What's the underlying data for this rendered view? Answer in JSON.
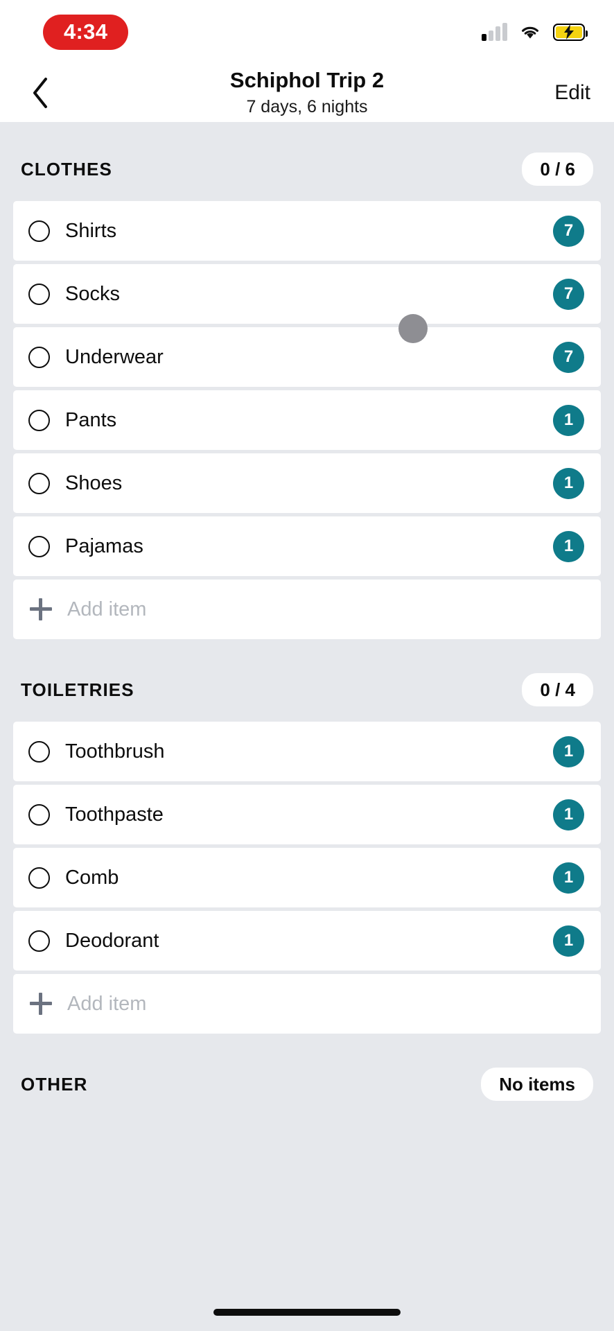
{
  "status_bar": {
    "time": "4:34",
    "time_pill_color": "#e02020",
    "signal_icon": "cellular-signal-icon",
    "wifi_icon": "wifi-icon",
    "battery_icon": "battery-charging-icon",
    "signal_bars_filled": 1,
    "signal_bars_total": 4
  },
  "navbar": {
    "back_icon": "chevron-left-icon",
    "title": "Schiphol Trip 2",
    "subtitle": "7 days, 6 nights",
    "edit_label": "Edit"
  },
  "theme": {
    "accent": "#0f7b8a",
    "page_background": "#e6e8ec",
    "card_background": "#ffffff",
    "text": "#0d0d0d",
    "placeholder": "#b3b7bd"
  },
  "add_item_label": "Add item",
  "sections": [
    {
      "title": "CLOTHES",
      "count": "0 / 6",
      "items": [
        {
          "label": "Shirts",
          "qty": "7"
        },
        {
          "label": "Socks",
          "qty": "7"
        },
        {
          "label": "Underwear",
          "qty": "7"
        },
        {
          "label": "Pants",
          "qty": "1"
        },
        {
          "label": "Shoes",
          "qty": "1"
        },
        {
          "label": "Pajamas",
          "qty": "1"
        }
      ]
    },
    {
      "title": "TOILETRIES",
      "count": "0 / 4",
      "items": [
        {
          "label": "Toothbrush",
          "qty": "1"
        },
        {
          "label": "Toothpaste",
          "qty": "1"
        },
        {
          "label": "Comb",
          "qty": "1"
        },
        {
          "label": "Deodorant",
          "qty": "1"
        }
      ]
    },
    {
      "title": "OTHER",
      "count": "No items",
      "items": []
    }
  ]
}
